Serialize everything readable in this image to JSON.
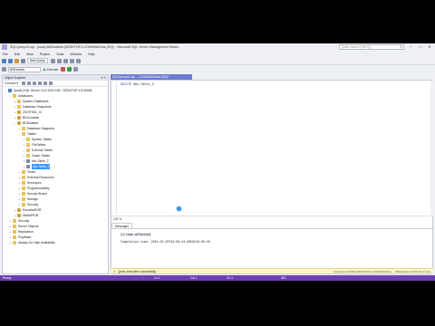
{
  "window": {
    "title": "SQLQuery12.sql - (local).BDEstafeta (DESKTOP-LOOM2MA\\Dios (52))* - Microsoft SQL Server Management Studio",
    "quick_launch_placeholder": "Quick Launch (Ctrl+Q)"
  },
  "menu": [
    "File",
    "Edit",
    "View",
    "Project",
    "Tools",
    "Window",
    "Help"
  ],
  "toolbar": {
    "new_query": "New Query",
    "database": "BDEstafeta",
    "execute": "Execute"
  },
  "object_explorer": {
    "title": "Object Explorer",
    "connect": "Connect ▾",
    "tree": [
      {
        "label": "(local) (SQL Server 14.0.1000.169 - DESKTOP-LOOM2M",
        "icon": "server",
        "depth": 0,
        "exp": "−"
      },
      {
        "label": "Databases",
        "icon": "folder",
        "depth": 1,
        "exp": "−"
      },
      {
        "label": "System Databases",
        "icon": "folder",
        "depth": 2,
        "exp": "+"
      },
      {
        "label": "Database Snapshots",
        "icon": "folder",
        "depth": 2,
        "exp": "+"
      },
      {
        "label": "2019TSSL_IC",
        "icon": "db",
        "depth": 2,
        "exp": "+"
      },
      {
        "label": "BDContacts",
        "icon": "db",
        "depth": 2,
        "exp": "+"
      },
      {
        "label": "BDEstafeta",
        "icon": "db",
        "depth": 2,
        "exp": "−"
      },
      {
        "label": "Database Diagrams",
        "icon": "folder",
        "depth": 3,
        "exp": "+"
      },
      {
        "label": "Tables",
        "icon": "folder",
        "depth": 3,
        "exp": "−"
      },
      {
        "label": "System Tables",
        "icon": "folder",
        "depth": 4,
        "exp": "+"
      },
      {
        "label": "FileTables",
        "icon": "folder",
        "depth": 4,
        "exp": "+"
      },
      {
        "label": "External Tables",
        "icon": "folder",
        "depth": 4,
        "exp": "+"
      },
      {
        "label": "Graph Tables",
        "icon": "folder",
        "depth": 4,
        "exp": "+"
      },
      {
        "label": "dbo.Table_2",
        "icon": "table",
        "depth": 4,
        "exp": "+"
      },
      {
        "label": "dbo.Table_3",
        "icon": "table",
        "depth": 4,
        "exp": "+",
        "selected": true
      },
      {
        "label": "Views",
        "icon": "folder",
        "depth": 3,
        "exp": "+"
      },
      {
        "label": "External Resources",
        "icon": "folder",
        "depth": 3,
        "exp": "+"
      },
      {
        "label": "Synonyms",
        "icon": "folder",
        "depth": 3,
        "exp": "+"
      },
      {
        "label": "Programmability",
        "icon": "folder",
        "depth": 3,
        "exp": "+"
      },
      {
        "label": "Service Broker",
        "icon": "folder",
        "depth": 3,
        "exp": "+"
      },
      {
        "label": "Storage",
        "icon": "folder",
        "depth": 3,
        "exp": "+"
      },
      {
        "label": "Security",
        "icon": "folder",
        "depth": 3,
        "exp": "+"
      },
      {
        "label": "EscuelaSIOR",
        "icon": "db",
        "depth": 2,
        "exp": "+"
      },
      {
        "label": "WebAPIDB",
        "icon": "db",
        "depth": 2,
        "exp": "+"
      },
      {
        "label": "Security",
        "icon": "folder",
        "depth": 1,
        "exp": "+"
      },
      {
        "label": "Server Objects",
        "icon": "folder",
        "depth": 1,
        "exp": "+"
      },
      {
        "label": "Replication",
        "icon": "folder",
        "depth": 1,
        "exp": "+"
      },
      {
        "label": "PolyBase",
        "icon": "folder",
        "depth": 1,
        "exp": "+"
      },
      {
        "label": "Always On High Availability",
        "icon": "folder",
        "depth": 1,
        "exp": "+"
      }
    ]
  },
  "editor": {
    "tab_label": "SQLQuery12.sql -...LOOM2MA\\Dios (52))*",
    "keyword": "DELETE",
    "statement": " dbo.Table_3",
    "zoom": "100 %"
  },
  "results": {
    "tab": "Messages",
    "line1": "(1 rows affected)",
    "line2": "Completion time: 2021-02-25T19:56:44.9956218-06:00",
    "zoom": "100 %"
  },
  "status": {
    "message": "Query executed successfully.",
    "right": "(local) (14.0 RTM)   DESKTOP-LOOM2MA\\Dios ...   BDEstafeta   00:00:00   0 rows"
  },
  "app_status": {
    "ready": "Ready",
    "ln": "Ln 1",
    "col": "Col 1",
    "ch": "Ch 1",
    "ins": "INS"
  },
  "colors": {
    "accent": "#6c3fb3",
    "tab_active": "#6b7bd1",
    "selection": "#3399ff"
  }
}
